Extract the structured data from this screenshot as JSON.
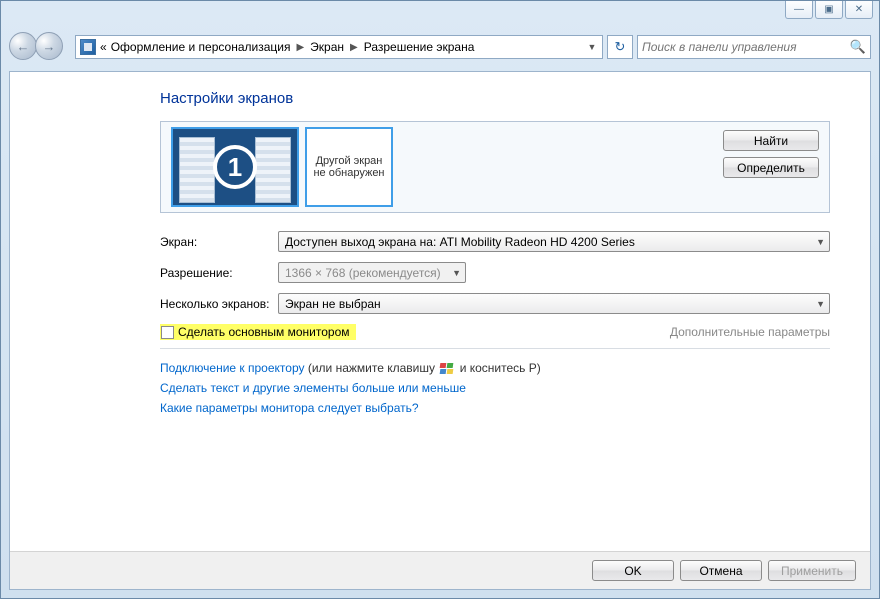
{
  "windowControls": {
    "minimize": "—",
    "maximize": "▣",
    "close": "✕"
  },
  "nav": {
    "back": "←",
    "forward": "→"
  },
  "breadcrumb": {
    "prefix": "«",
    "item1": "Оформление и персонализация",
    "item2": "Экран",
    "item3": "Разрешение экрана"
  },
  "refresh": "↻",
  "search": {
    "placeholder": "Поиск в панели управления",
    "icon": "🔍"
  },
  "page": {
    "title": "Настройки экранов",
    "monitor1_num": "1",
    "monitor2_text": "Другой экран не обнаружен",
    "btn_find": "Найти",
    "btn_identify": "Определить"
  },
  "form": {
    "screen_label": "Экран:",
    "screen_value": "Доступен выход экрана на: ATI Mobility Radeon HD 4200 Series",
    "resolution_label": "Разрешение:",
    "resolution_value": "1366 × 768 (рекомендуется)",
    "multi_label": "Несколько экранов:",
    "multi_value": "Экран не выбран",
    "make_primary": "Сделать основным монитором",
    "advanced": "Дополнительные параметры"
  },
  "links": {
    "projector_link": "Подключение к проектору",
    "projector_suffix1": " (или нажмите клавишу ",
    "projector_suffix2": " и коснитесь P)",
    "text_size": "Сделать текст и другие элементы больше или меньше",
    "which_settings": "Какие параметры монитора следует выбрать?"
  },
  "buttons": {
    "ok": "OK",
    "cancel": "Отмена",
    "apply": "Применить"
  }
}
